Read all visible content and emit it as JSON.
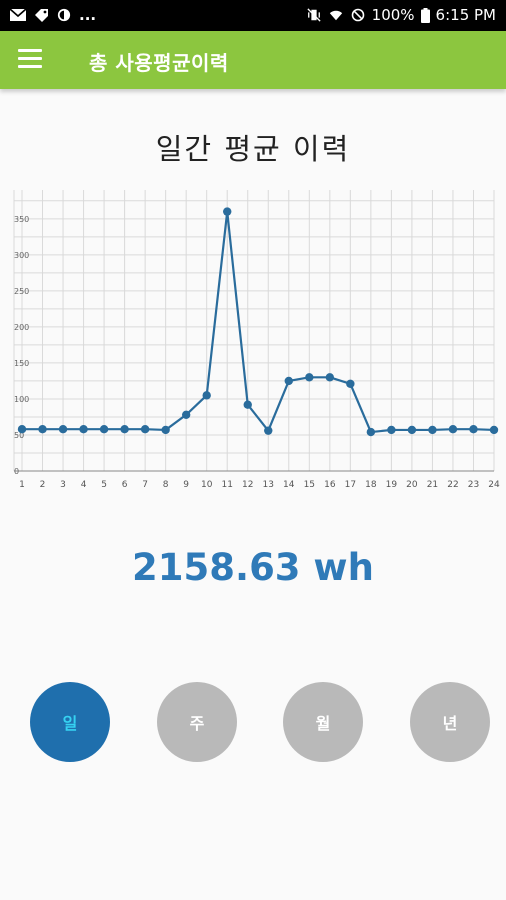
{
  "status_bar": {
    "left_more": "...",
    "battery": "100%",
    "time": "6:15 PM"
  },
  "app_bar": {
    "title": "총 사용평균이력",
    "menu_icon": "hamburger-menu-icon"
  },
  "page": {
    "chart_title": "일간 평균 이력",
    "total_value": "2158.63 wh"
  },
  "period_buttons": [
    {
      "label": "일",
      "selected": true
    },
    {
      "label": "주",
      "selected": false
    },
    {
      "label": "월",
      "selected": false
    },
    {
      "label": "년",
      "selected": false
    }
  ],
  "colors": {
    "app_bar": "#8cc63f",
    "accent": "#1f6fad",
    "line": "#2a6c9c",
    "unselected_button": "#b9b9b9",
    "selected_button_text": "#36d2f2",
    "total_value_text": "#2f7ab8"
  },
  "chart_data": {
    "type": "line",
    "x": [
      1,
      2,
      3,
      4,
      5,
      6,
      7,
      8,
      9,
      10,
      11,
      12,
      13,
      14,
      15,
      16,
      17,
      18,
      19,
      20,
      21,
      22,
      23,
      24
    ],
    "series": [
      {
        "values": [
          58,
          58,
          58,
          58,
          58,
          58,
          58,
          57,
          78,
          105,
          360,
          92,
          56,
          125,
          130,
          130,
          121,
          54,
          57,
          57,
          57,
          58,
          58,
          57
        ]
      }
    ],
    "y_ticks": [
      0,
      50,
      100,
      150,
      200,
      250,
      300,
      350
    ],
    "ylim": [
      0,
      390
    ],
    "grid": true
  }
}
